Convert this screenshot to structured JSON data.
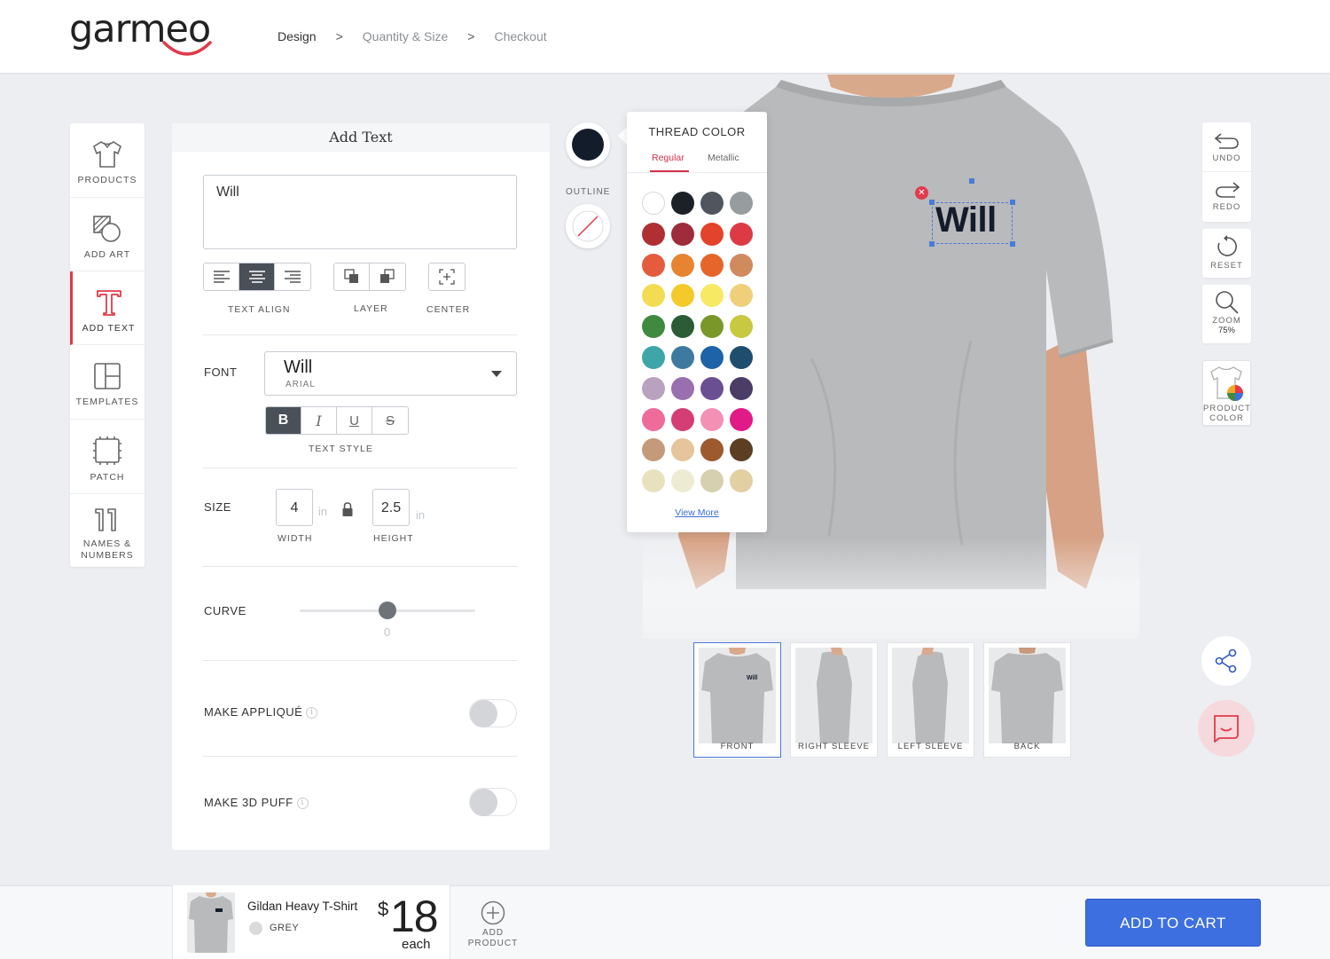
{
  "brand": {
    "logo": "garmeo",
    "accent": "#e13a4a"
  },
  "breadcrumb": {
    "steps": [
      "Design",
      "Quantity & Size",
      "Checkout"
    ],
    "separator": ">"
  },
  "sidebar": {
    "items": [
      {
        "label": "PRODUCTS",
        "icon": "shirt-icon"
      },
      {
        "label": "ADD ART",
        "icon": "art-icon"
      },
      {
        "label": "ADD TEXT",
        "icon": "text-icon",
        "active": true
      },
      {
        "label": "TEMPLATES",
        "icon": "templates-icon"
      },
      {
        "label": "PATCH",
        "icon": "patch-icon"
      },
      {
        "label": "NAMES &",
        "label2": "NUMBERS",
        "icon": "numbers-icon"
      }
    ]
  },
  "panel": {
    "title": "Add Text",
    "text_value": "Will",
    "text_align_caption": "TEXT ALIGN",
    "layer_caption": "LAYER",
    "center_caption": "CENTER",
    "font_label": "FONT",
    "font_name": "Will",
    "font_family": "ARIAL",
    "text_style_caption": "TEXT STYLE",
    "style_buttons": [
      "B",
      "I",
      "U",
      "S"
    ],
    "size_label": "SIZE",
    "width_value": "4",
    "width_unit": "in",
    "width_caption": "WIDTH",
    "height_value": "2.5",
    "height_unit": "in",
    "height_caption": "HEIGHT",
    "curve_label": "CURVE",
    "curve_value": "0",
    "applique_label": "MAKE APPLIQUÉ",
    "puff_label": "MAKE 3D PUFF"
  },
  "thread": {
    "outline_label": "OUTLINE",
    "selected_color": "#131c2b",
    "popup_title": "THREAD COLOR",
    "tabs": [
      "Regular",
      "Metallic"
    ],
    "view_more": "View More",
    "swatches": [
      [
        "#ffffff",
        "#1c2128",
        "#50555e",
        "#979c9f"
      ],
      [
        "#b02f33",
        "#9e2c3a",
        "#e2432a",
        "#dc3b46"
      ],
      [
        "#e45b3d",
        "#e78430",
        "#e5652a",
        "#cf8a5e"
      ],
      [
        "#f2dd52",
        "#f4c92a",
        "#f7e964",
        "#f0cf7a"
      ],
      [
        "#3f8a3f",
        "#2b5c36",
        "#7a982a",
        "#c8c841"
      ],
      [
        "#3ea5a8",
        "#3e7aa0",
        "#1e63a8",
        "#1e4d6e"
      ],
      [
        "#b9a1c0",
        "#9a6fb0",
        "#6a4f93",
        "#4a3d66"
      ],
      [
        "#ef6c9a",
        "#d43e75",
        "#f590b5",
        "#e01a86"
      ],
      [
        "#c49a7a",
        "#e6c59c",
        "#9c5a2e",
        "#5c3f22"
      ],
      [
        "#e7e1be",
        "#eeebd3",
        "#d6d0ae",
        "#e2cfa2"
      ]
    ]
  },
  "design": {
    "text": "Will"
  },
  "views": [
    "FRONT",
    "RIGHT SLEEVE",
    "LEFT SLEEVE",
    "BACK"
  ],
  "tools": {
    "undo": "UNDO",
    "redo": "REDO",
    "reset": "RESET",
    "zoom": "ZOOM",
    "zoom_level": "75%",
    "product_color_1": "PRODUCT",
    "product_color_2": "COLOR"
  },
  "footer": {
    "product_name": "Gildan Heavy T-Shirt",
    "product_color": "GREY",
    "currency": "$",
    "price": "18",
    "price_unit": "each",
    "add_product_1": "ADD",
    "add_product_2": "PRODUCT",
    "cart_button": "ADD TO CART",
    "cart_color": "#3d6fe0"
  }
}
